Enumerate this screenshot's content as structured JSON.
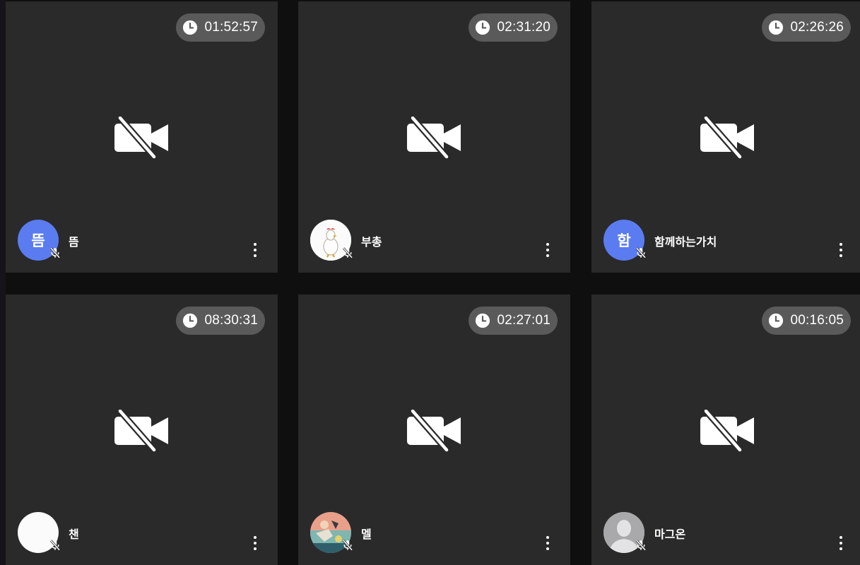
{
  "participants": [
    {
      "name": "뜸",
      "avatar_text": "뜸",
      "avatar_type": "initial",
      "avatar_color": "#5b7cf0",
      "timer": "01:52:57",
      "camera": "off",
      "mic": "muted"
    },
    {
      "name": "부총",
      "avatar_text": "",
      "avatar_type": "image-duck",
      "avatar_color": "#fbfbfb",
      "timer": "02:31:20",
      "camera": "off",
      "mic": "muted"
    },
    {
      "name": "함께하는가치",
      "avatar_text": "함",
      "avatar_type": "initial",
      "avatar_color": "#5b7cf0",
      "timer": "02:26:26",
      "camera": "off",
      "mic": "muted"
    },
    {
      "name": "챈",
      "avatar_text": "",
      "avatar_type": "blank-white",
      "avatar_color": "#fbfbfb",
      "timer": "08:30:31",
      "camera": "off",
      "mic": "muted"
    },
    {
      "name": "멜",
      "avatar_text": "",
      "avatar_type": "image-photo",
      "avatar_color": "#e8a08a",
      "timer": "02:27:01",
      "camera": "off",
      "mic": "muted"
    },
    {
      "name": "마그온",
      "avatar_text": "",
      "avatar_type": "default-person",
      "avatar_color": "#a9a9ab",
      "timer": "00:16:05",
      "camera": "off",
      "mic": "muted"
    }
  ],
  "icons": {
    "timer": "clock-icon",
    "camera": "video-off-icon",
    "mic": "mic-off-icon",
    "menu": "more-vert-icon"
  }
}
